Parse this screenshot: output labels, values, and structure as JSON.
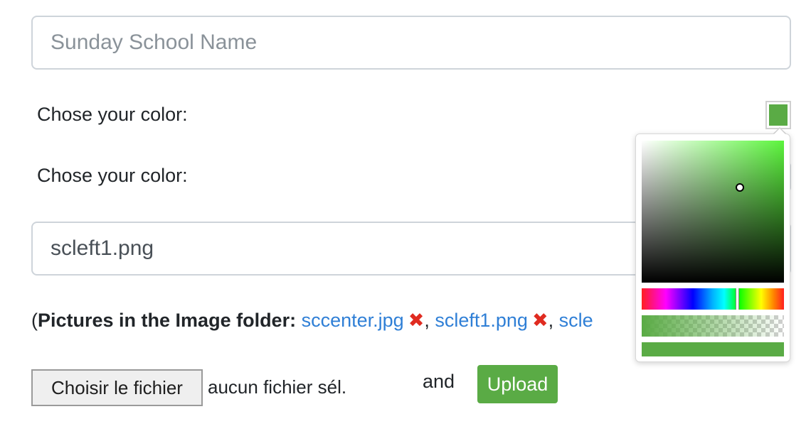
{
  "form": {
    "name_placeholder": "Sunday School Name",
    "color_label_1": "Chose your color:",
    "color_label_2": "Chose your color:",
    "file_name_value": "scleft1.png",
    "selected_color": "#5aab45"
  },
  "pictures": {
    "open_paren": "(",
    "label": "Pictures in the Image folder:",
    "files": [
      "sccenter.jpg",
      "scleft1.png",
      "scle"
    ],
    "delete_glyph": "✖",
    "separator": ","
  },
  "upload": {
    "choose_file_label": "Choisir le fichier",
    "file_status": "aucun fichier sél.",
    "and_text": "and",
    "upload_label": "Upload",
    "upload_color": "#5aab45"
  },
  "color_picker": {
    "hue_color": "#5cf53d",
    "current_color": "#5aab45"
  }
}
